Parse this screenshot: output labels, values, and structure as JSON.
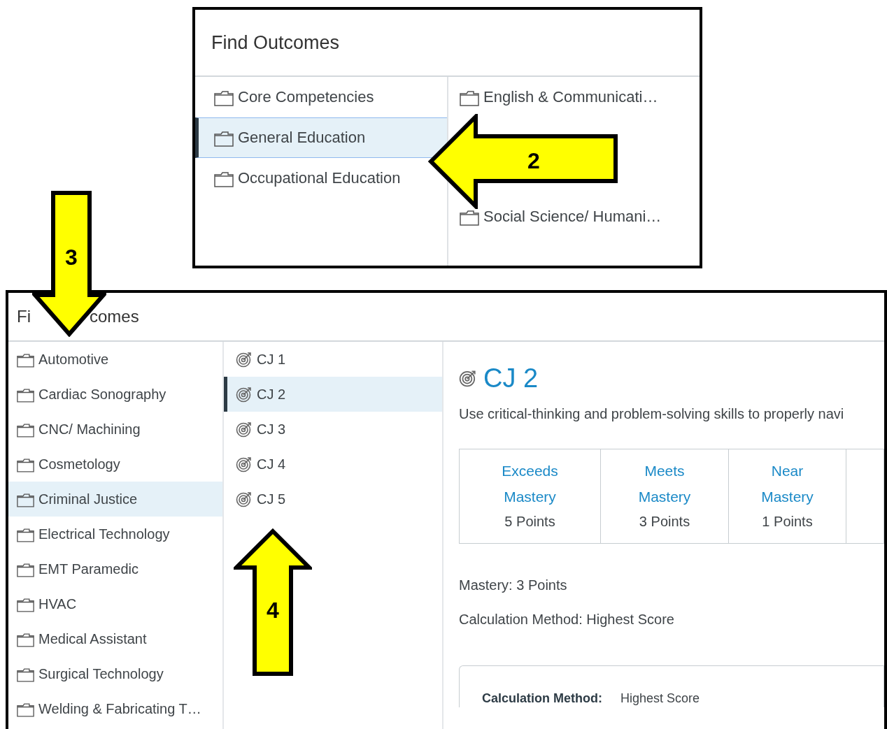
{
  "annotations": [
    {
      "number": "2"
    },
    {
      "number": "3"
    },
    {
      "number": "4"
    }
  ],
  "top_panel": {
    "title": "Find Outcomes",
    "groups": [
      {
        "label": "Core Competencies",
        "selected": false
      },
      {
        "label": "General Education",
        "selected": true
      },
      {
        "label": "Occupational Education",
        "selected": false
      }
    ],
    "subgroups": [
      {
        "kind": "folder",
        "label": "English & Communicati…"
      },
      {
        "kind": "covered"
      },
      {
        "kind": "covered"
      },
      {
        "kind": "folder",
        "label": "Social Science/ Humani…"
      }
    ]
  },
  "bottom_panel": {
    "title_parts": [
      "Fi",
      "comes"
    ],
    "programs": [
      {
        "label": "Automotive",
        "selected": false
      },
      {
        "label": "Cardiac Sonography",
        "selected": false
      },
      {
        "label": "CNC/ Machining",
        "selected": false
      },
      {
        "label": "Cosmetology",
        "selected": false
      },
      {
        "label": "Criminal Justice",
        "selected": true
      },
      {
        "label": "Electrical Technology",
        "selected": false
      },
      {
        "label": "EMT Paramedic",
        "selected": false
      },
      {
        "label": "HVAC",
        "selected": false
      },
      {
        "label": "Medical Assistant",
        "selected": false
      },
      {
        "label": "Surgical Technology",
        "selected": false
      },
      {
        "label": "Welding & Fabricating T…",
        "selected": false
      }
    ],
    "outcomes": [
      {
        "label": "CJ 1",
        "selected": false
      },
      {
        "label": "CJ 2",
        "selected": true
      },
      {
        "label": "CJ 3",
        "selected": false
      },
      {
        "label": "CJ 4",
        "selected": false
      },
      {
        "label": "CJ 5",
        "selected": false
      }
    ],
    "detail": {
      "title": "CJ 2",
      "description": "Use critical-thinking and problem-solving skills to properly navi",
      "ratings": [
        {
          "label": "Exceeds Mastery",
          "points": "5 Points"
        },
        {
          "label": "Meets Mastery",
          "points": "3 Points"
        },
        {
          "label": "Near Mastery",
          "points": "1 Points"
        }
      ],
      "mastery": "Mastery: 3 Points",
      "calculation": "Calculation Method: Highest Score",
      "box": {
        "label": "Calculation Method:",
        "value": "Highest Score"
      }
    }
  }
}
